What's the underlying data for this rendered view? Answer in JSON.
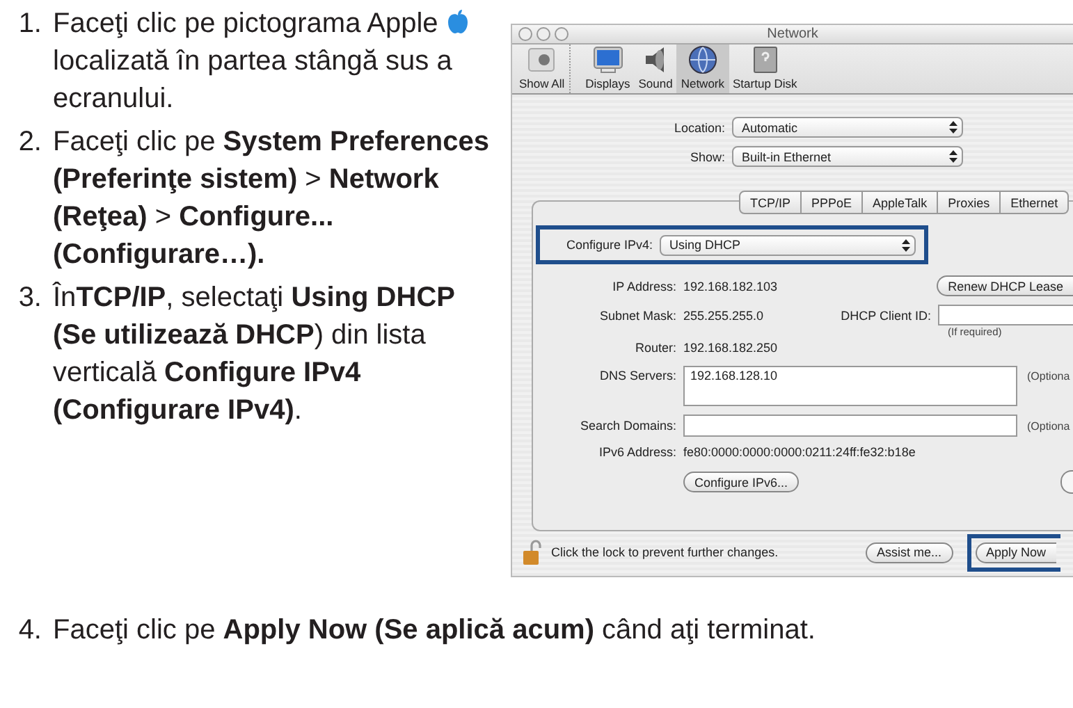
{
  "steps": [
    {
      "number": "1.",
      "text_before": "Faceţi clic pe pictograma Apple",
      "text_after": "localizată în partea stângă sus a ecranului."
    },
    {
      "number": "2.",
      "text": "Faceţi clic pe **System Preferences (Preferinţe sistem)** > **Network (Reţea)** > **Configure... (Configurare…).**"
    },
    {
      "number": "3.",
      "text": "În**TCP/IP**, selectaţi **Using DHCP (Se utilizează DHCP**) din lista verticală **Configure IPv4 (Configurare IPv4)**."
    },
    {
      "number": "4.",
      "text": "Faceţi clic pe **Apply Now (Se aplică acum)** când aţi terminat."
    }
  ],
  "window": {
    "title": "Network",
    "toolbar": [
      {
        "kind": "showall",
        "label": "Show All",
        "selected": false
      },
      {
        "kind": "displays",
        "label": "Displays",
        "selected": false
      },
      {
        "kind": "sound",
        "label": "Sound",
        "selected": false
      },
      {
        "kind": "network",
        "label": "Network",
        "selected": true
      },
      {
        "kind": "disk",
        "label": "Startup Disk",
        "selected": false
      }
    ],
    "location": {
      "label": "Location:",
      "value": "Automatic"
    },
    "show": {
      "label": "Show:",
      "value": "Built-in Ethernet"
    },
    "tabs": [
      "TCP/IP",
      "PPPoE",
      "AppleTalk",
      "Proxies",
      "Ethernet"
    ],
    "configure": {
      "label": "Configure IPv4:",
      "value": "Using DHCP",
      "highlighted": true
    },
    "ip": {
      "label": "IP Address:",
      "value": "192.168.182.103"
    },
    "renew_button": "Renew DHCP Lease",
    "subnet": {
      "label": "Subnet Mask:",
      "value": "255.255.255.0"
    },
    "client_id": {
      "label": "DHCP Client ID:",
      "hint": "(If required)"
    },
    "router": {
      "label": "Router:",
      "value": "192.168.182.250"
    },
    "dns": {
      "label": "DNS Servers:",
      "value": "192.168.128.10",
      "note": "(Optiona"
    },
    "search_domains": {
      "label": "Search Domains:",
      "note": "(Optiona"
    },
    "ipv6": {
      "label": "IPv6 Address:",
      "value": "fe80:0000:0000:0000:0211:24ff:fe32:b18e"
    },
    "configure_ipv6_button": "Configure IPv6...",
    "lock_text": "Click the lock to prevent further changes.",
    "assist_button": "Assist me...",
    "apply_button": {
      "label": "Apply Now",
      "highlighted": true
    }
  }
}
